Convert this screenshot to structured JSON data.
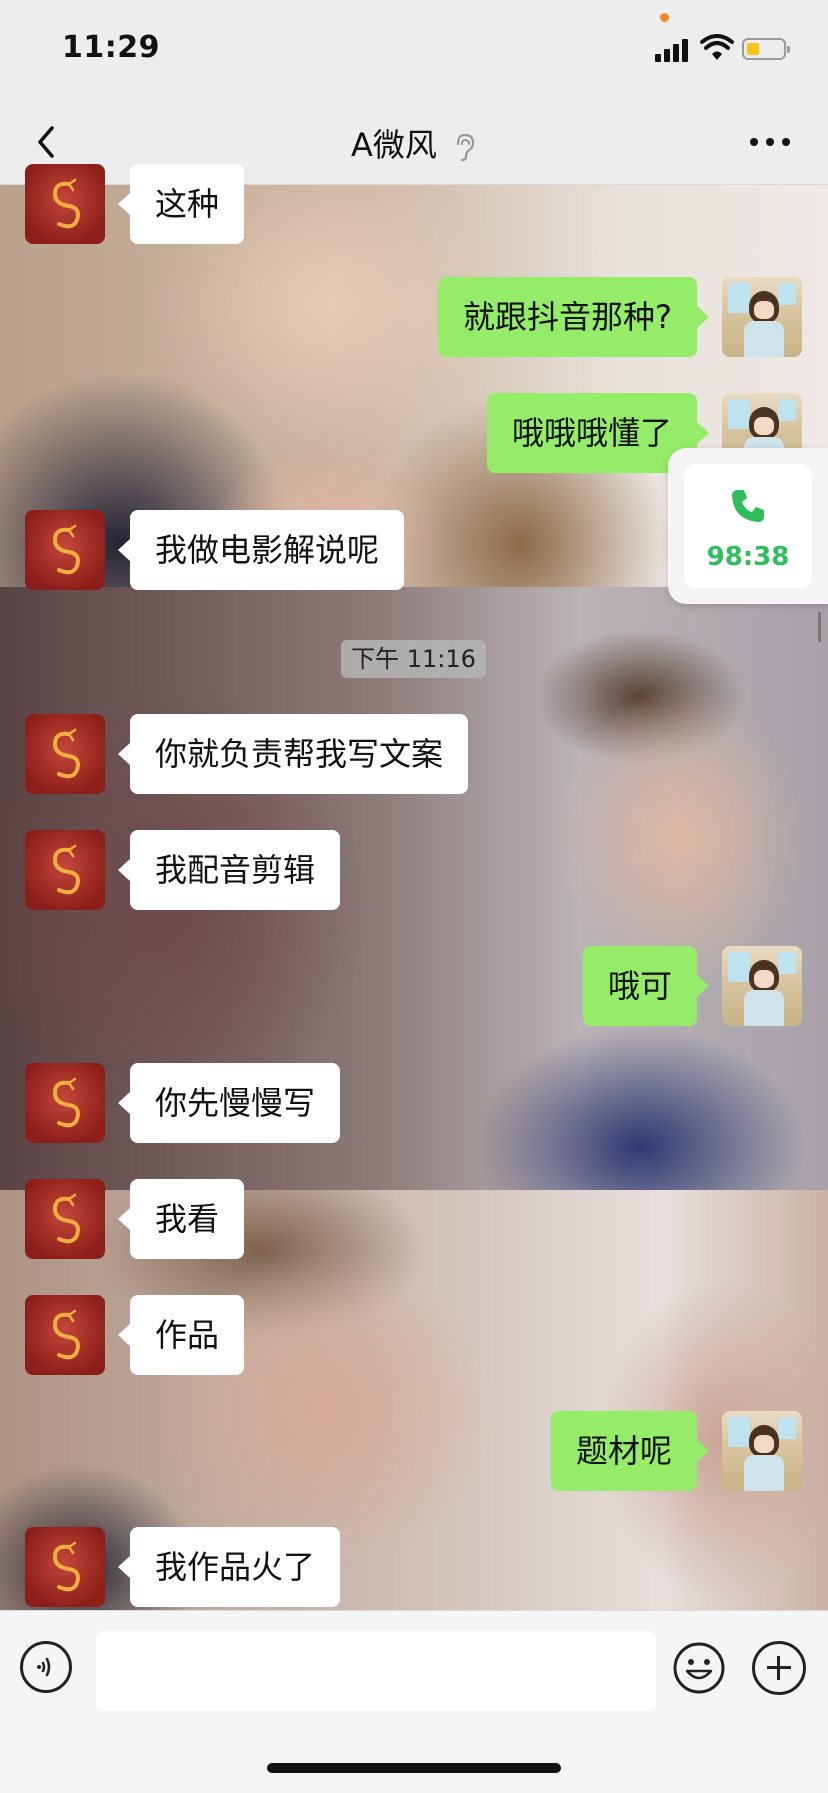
{
  "status_bar": {
    "time": "11:29",
    "battery_level": 0.25,
    "indicator_color": "#f28a2b"
  },
  "header": {
    "back_icon": "chevron-left-icon",
    "title": "A微风",
    "mute_icon": "ear-icon",
    "more_icon": "more-dots-icon"
  },
  "messages": [
    {
      "side": "in",
      "text": "这种"
    },
    {
      "side": "out",
      "text": "就跟抖音那种?"
    },
    {
      "side": "out",
      "text": "哦哦哦懂了"
    },
    {
      "side": "in",
      "text": "我做电影解说呢"
    },
    {
      "side": "in",
      "text": "你就负责帮我写文案"
    },
    {
      "side": "in",
      "text": "我配音剪辑"
    },
    {
      "side": "out",
      "text": "哦可"
    },
    {
      "side": "in",
      "text": "你先慢慢写"
    },
    {
      "side": "in",
      "text": "我看"
    },
    {
      "side": "in",
      "text": "作品"
    },
    {
      "side": "out",
      "text": "题材呢"
    },
    {
      "side": "in",
      "text": "我作品火了"
    }
  ],
  "timestamp": "下午 11:16",
  "floating_call": {
    "icon": "phone-icon",
    "duration": "98:38",
    "color": "#2fbf5a"
  },
  "composer": {
    "voice_icon": "voice-icon",
    "input_value": "",
    "emoji_icon": "emoji-icon",
    "plus_icon": "plus-icon"
  },
  "colors": {
    "bubble_out": "#95ec69",
    "bubble_in": "#ffffff",
    "bar_bg": "#ededed"
  }
}
